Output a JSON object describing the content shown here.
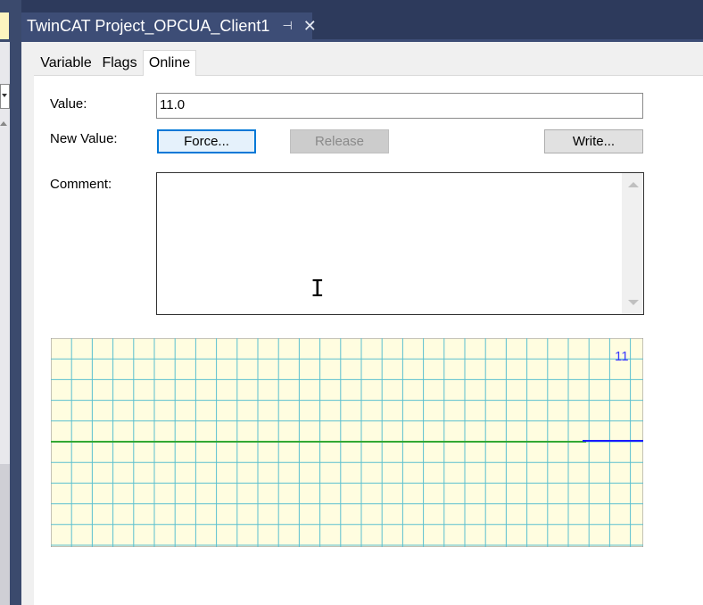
{
  "window": {
    "doc_tab_title": "TwinCAT Project_OPCUA_Client1",
    "pin_glyph": "⊣",
    "close_glyph": "✕"
  },
  "tabs": [
    {
      "label": "Variable",
      "active": false
    },
    {
      "label": "Flags",
      "active": false
    },
    {
      "label": "Online",
      "active": true
    }
  ],
  "online": {
    "value_label": "Value:",
    "value": "11.0",
    "new_value_label": "New Value:",
    "force_button": "Force...",
    "release_button": "Release",
    "write_button": "Write...",
    "comment_label": "Comment:",
    "comment": ""
  },
  "chart_data": {
    "type": "line",
    "value_label": "11",
    "grid": true,
    "background": "#fffde0",
    "grid_color": "#5bc0d0",
    "series": [
      {
        "color": "#33a833",
        "values": [
          11,
          11
        ]
      },
      {
        "color": "#1a1aff",
        "values": [
          11,
          11
        ]
      }
    ]
  },
  "colors": {
    "accent": "#3d4d76",
    "focus": "#0078d7"
  }
}
